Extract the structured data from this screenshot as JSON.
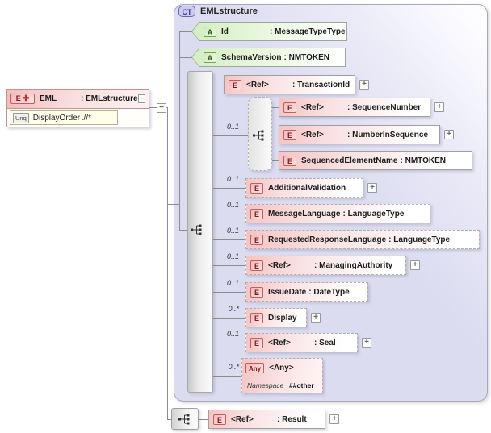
{
  "glyphs": {
    "expand": "+",
    "collapse": "−",
    "element_plus": "✚"
  },
  "eml": {
    "badge": "E",
    "name": "EML",
    "type": ": EMLstructure",
    "unique": {
      "badge": "Unq",
      "name": "DisplayOrder",
      "selector": ".//*"
    }
  },
  "complex_type": {
    "badge": "CT",
    "title": "EMLstructure",
    "attributes": [
      {
        "badge": "A",
        "name": "Id",
        "type": ": MessageTypeType"
      },
      {
        "badge": "A",
        "name": "SchemaVersion",
        "type": ": NMTOKEN"
      }
    ],
    "group_occurrence": "0..1",
    "elements": [
      {
        "id": "transactionid",
        "badge": "E",
        "name": "<Ref>",
        "type": ": TransactionId",
        "occurrence": "",
        "optional": false,
        "expandable": true
      },
      {
        "id": "sequencenumber",
        "badge": "E",
        "name": "<Ref>",
        "type": ": SequenceNumber",
        "occurrence": "",
        "optional": false,
        "expandable": true
      },
      {
        "id": "numberinsequence",
        "badge": "E",
        "name": "<Ref>",
        "type": ": NumberInSequence",
        "occurrence": "",
        "optional": false,
        "expandable": true
      },
      {
        "id": "sequencedelementname",
        "badge": "E",
        "name": "SequencedElementName",
        "type": ": NMTOKEN",
        "occurrence": "",
        "optional": false,
        "expandable": false
      },
      {
        "id": "additionalvalidation",
        "badge": "E",
        "name": "AdditionalValidation",
        "type": "",
        "occurrence": "0..1",
        "optional": true,
        "expandable": true
      },
      {
        "id": "messagelanguage",
        "badge": "E",
        "name": "MessageLanguage",
        "type": ": LanguageType",
        "occurrence": "0..1",
        "optional": true,
        "expandable": false
      },
      {
        "id": "requestedresponselanguage",
        "badge": "E",
        "name": "RequestedResponseLanguage",
        "type": ": LanguageType",
        "occurrence": "0..1",
        "optional": true,
        "expandable": false
      },
      {
        "id": "managingauthority",
        "badge": "E",
        "name": "<Ref>",
        "type": ": ManagingAuthority",
        "occurrence": "0..1",
        "optional": true,
        "expandable": true
      },
      {
        "id": "issuedate",
        "badge": "E",
        "name": "IssueDate",
        "type": ": DateType",
        "occurrence": "0..1",
        "optional": true,
        "expandable": false
      },
      {
        "id": "display",
        "badge": "E",
        "name": "Display",
        "type": "",
        "occurrence": "0..*",
        "optional": true,
        "expandable": true
      },
      {
        "id": "seal",
        "badge": "E",
        "name": "<Ref>",
        "type": ": Seal",
        "occurrence": "0..1",
        "optional": true,
        "expandable": true
      }
    ],
    "any": {
      "occurrence": "0..*",
      "badge": "Any",
      "name": "<Any>",
      "namespace_label": "Namespace",
      "namespace_value": "##other"
    }
  },
  "result": {
    "badge": "E",
    "name": "<Ref>",
    "type": ": Result",
    "expandable": true
  }
}
